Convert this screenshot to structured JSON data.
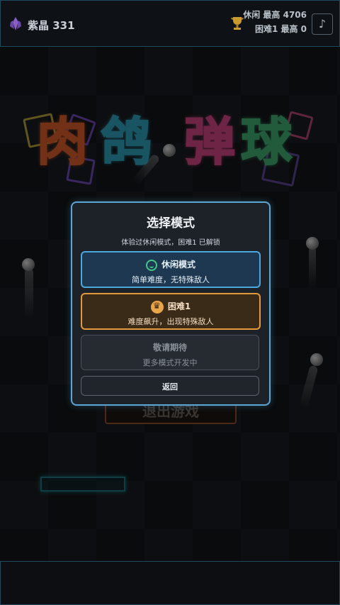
{
  "header": {
    "crystal_label": "紫晶 331",
    "casual_best": "休闲 最高 4706",
    "hard_best": "困难1 最高 0",
    "music_icon": "♪"
  },
  "game_title": {
    "chars": [
      "肉",
      "鸽",
      "弹",
      "球"
    ],
    "colors": [
      "#d05a2a",
      "#2f9ab3",
      "#c8437d",
      "#3fa66e"
    ]
  },
  "background": {
    "exit_button_label": "退出游戏"
  },
  "modal": {
    "title": "选择模式",
    "subtitle": "体验过休闲模式，困难1 已解锁",
    "options": [
      {
        "name": "休闲模式",
        "desc": "简单难度，无特殊敌人"
      },
      {
        "name": "困难1",
        "desc": "难度飙升，出现特殊敌人"
      },
      {
        "name": "敬请期待",
        "desc": "更多模式开发中"
      }
    ],
    "back_label": "返回"
  },
  "colors": {
    "accent_blue": "#4ca8e0",
    "accent_orange": "#e39a3a",
    "panel_border": "#5aa7d6"
  }
}
